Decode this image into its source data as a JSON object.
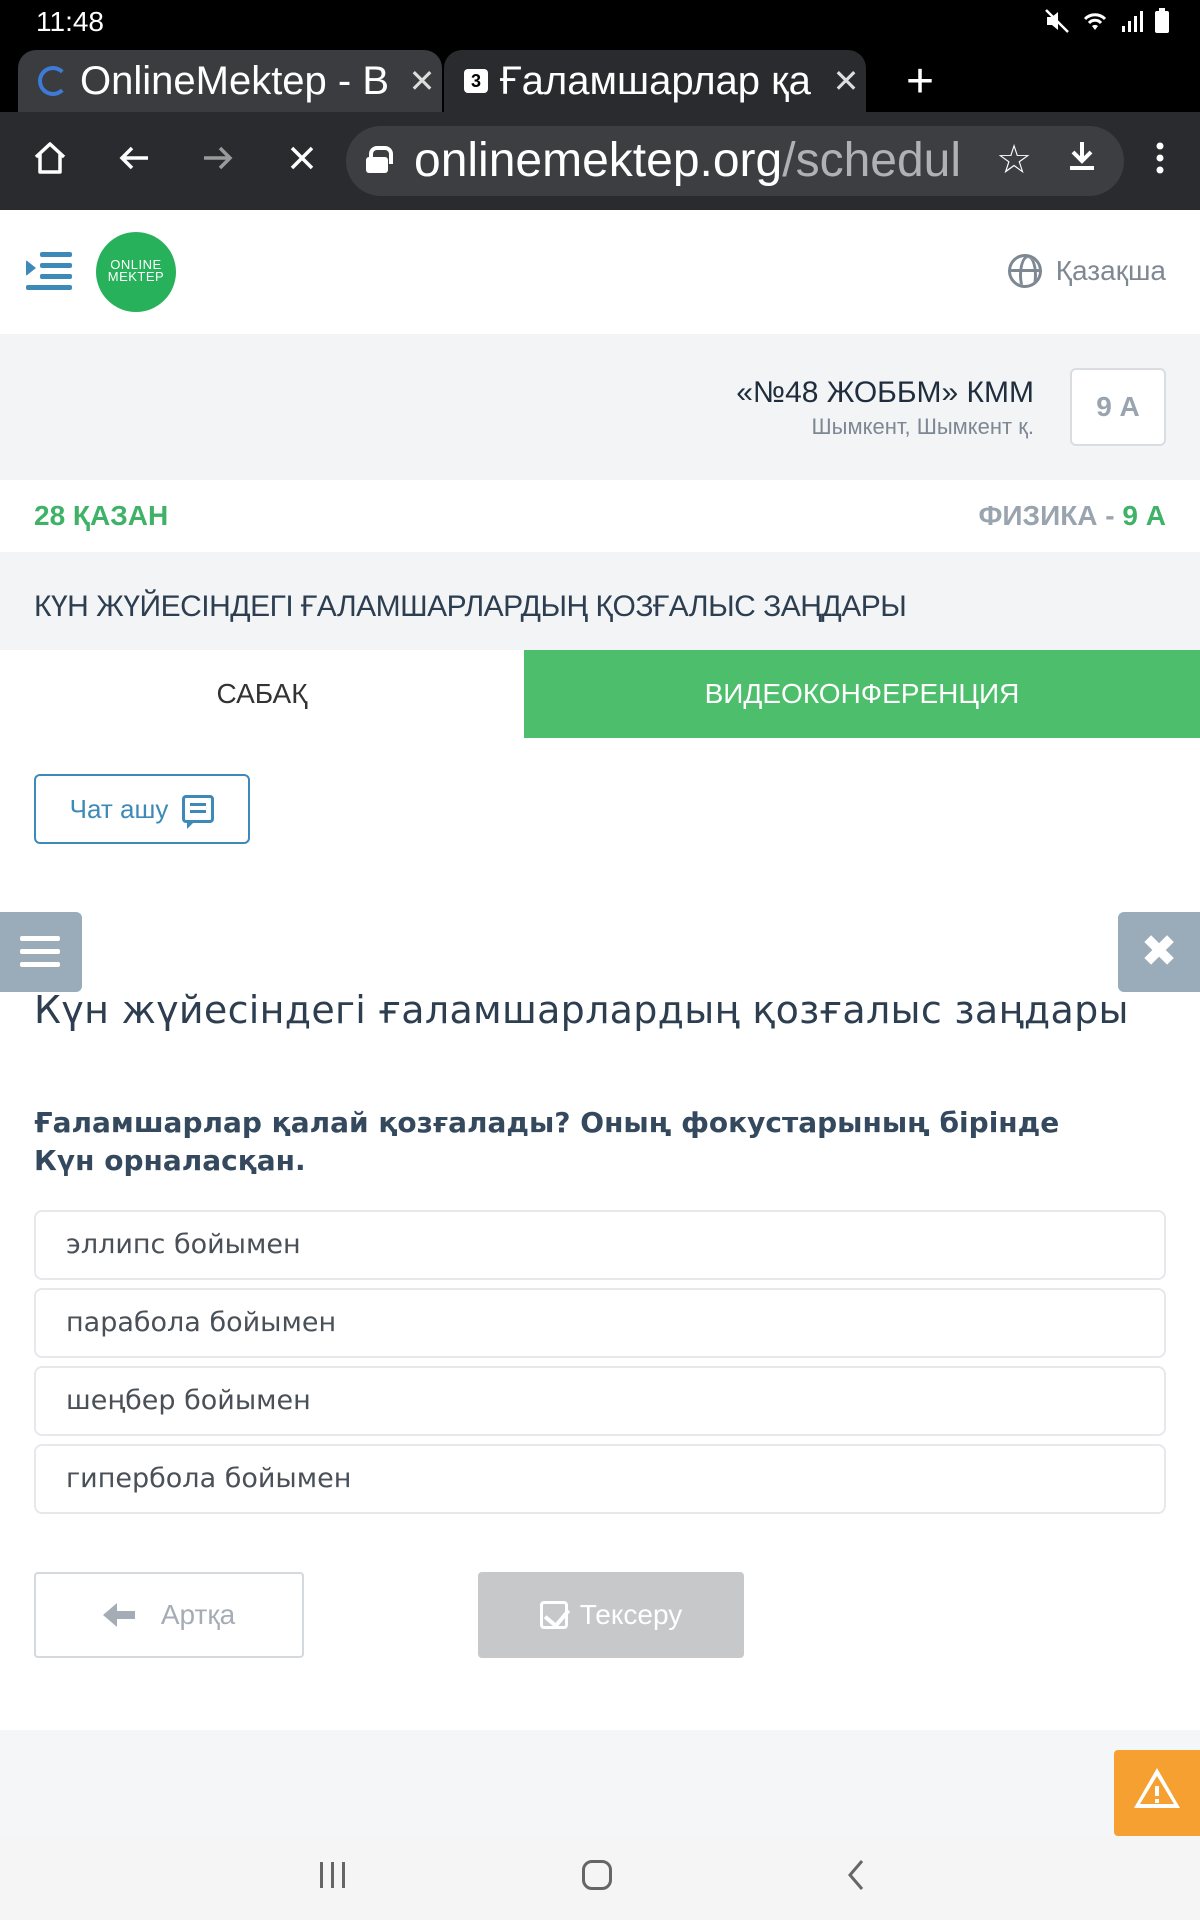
{
  "status_bar": {
    "time": "11:48",
    "icons": [
      "mute-icon",
      "wifi-icon",
      "signal-icon",
      "battery-icon"
    ]
  },
  "browser": {
    "tabs": [
      {
        "title": "OnlineMektep - B",
        "favicon": "loading-spinner-icon"
      },
      {
        "title": "Ғаламшарлар қа",
        "favicon": "number-3-icon",
        "favicon_text": "3"
      }
    ],
    "url_host": "onlinemektep.org",
    "url_path": "/schedul"
  },
  "header": {
    "logo_line1": "ONLINE",
    "logo_line2": "MEKTEP",
    "language": "Қазақша"
  },
  "school": {
    "name": "«№48 ЖОББМ» КММ",
    "city": "Шымкент, Шымкент қ.",
    "class": "9 А"
  },
  "lesson": {
    "date": "28 ҚАЗАН",
    "subject": "ФИЗИКА - ",
    "subject_class": "9 А",
    "topic": "КҮН ЖҮЙЕСІНДЕГІ ҒАЛАМШАРЛАРДЫҢ ҚОЗҒАЛЫС ЗАҢДАРЫ"
  },
  "tabs": {
    "lesson": "САБАҚ",
    "video": "ВИДЕОКОНФЕРЕНЦИЯ",
    "active": "video"
  },
  "chat": {
    "label": "Чат ашу"
  },
  "quiz": {
    "title": "Күн жүйесіндегі ғаламшарлардың қозғалыс заңдары",
    "question": "Ғаламшарлар қалай қозғалады? Оның фокустарының бірінде Күн орналасқан.",
    "options": [
      "эллипс бойымен",
      "парабола бойымен",
      "шеңбер бойымен",
      "гипербола бойымен"
    ],
    "back_label": "Артқа",
    "check_label": "Тексеру"
  },
  "colors": {
    "accent_green": "#4dbe6b",
    "link_blue": "#3d8ab8",
    "warning_orange": "#f5a030",
    "disabled_gray": "#c6c8ca"
  }
}
